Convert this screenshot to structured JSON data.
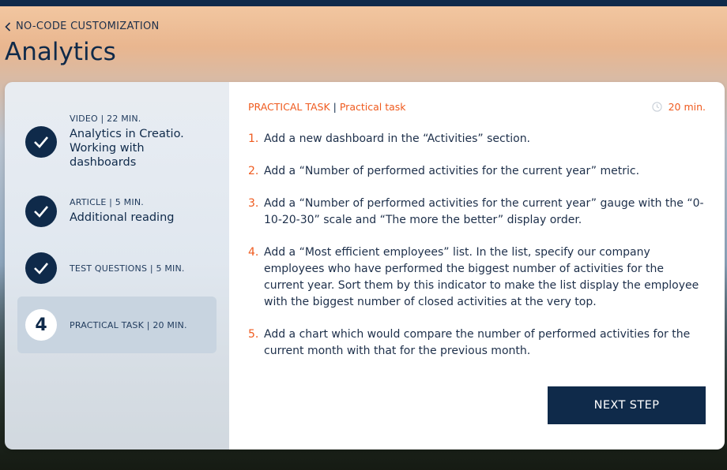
{
  "nav": {
    "back_label": "NO-CODE CUSTOMIZATION"
  },
  "page": {
    "title": "Analytics"
  },
  "sidebar": {
    "steps": [
      {
        "meta": "VIDEO | 22 MIN.",
        "name": "Analytics in Creatio. Working with dashboards",
        "status": "completed",
        "icon": "check-icon"
      },
      {
        "meta": "ARTICLE | 5 MIN.",
        "name": "Additional reading",
        "status": "completed",
        "icon": "check-icon"
      },
      {
        "meta": "TEST QUESTIONS | 5 MIN.",
        "name": "",
        "status": "completed",
        "icon": "check-icon"
      },
      {
        "meta": "PRACTICAL TASK | 20 MIN.",
        "name": "",
        "status": "active",
        "number": "4"
      }
    ]
  },
  "content": {
    "type_label": "PRACTICAL TASK",
    "separator": "|",
    "task_label": "Practical task",
    "duration": "20 min.",
    "tasks": [
      {
        "num": "1.",
        "text": "Add a new dashboard in the “Activities” section."
      },
      {
        "num": "2.",
        "text": "Add a “Number of performed activities for the current year” metric."
      },
      {
        "num": "3.",
        "text": "Add a “Number of performed activities for the current year” gauge with the  “0-10-20-30” scale and “The more the better” display order."
      },
      {
        "num": "4.",
        "text": "Add a “Most efficient employees” list. In the list, specify our company employees who have performed the biggest number of activities for the current year. Sort them by this indicator to make the list display the employee with the biggest number of closed activities at the very top."
      },
      {
        "num": "5.",
        "text": "Add a chart which would compare the number of performed activities for the current month with that for the previous month."
      }
    ],
    "next_button": "NEXT STEP"
  },
  "colors": {
    "accent": "#ef5a1e",
    "primary": "#0f2a4a"
  }
}
